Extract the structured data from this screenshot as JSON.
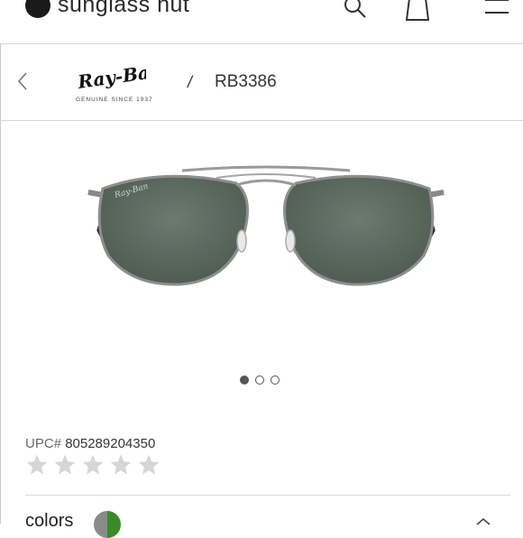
{
  "header": {
    "brand_name": "sunglass hut",
    "icons": [
      "search-icon",
      "shopping-bag-icon",
      "menu-icon"
    ]
  },
  "breadcrumb": {
    "brand_logo_text": "Ray-Ban",
    "brand_tagline": "GENUINE SINCE 1937",
    "separator": "/",
    "model": "RB3386"
  },
  "gallery": {
    "image_count": 3,
    "active_index": 0
  },
  "product": {
    "upc_label": "UPC#",
    "upc_value": "805289204350",
    "rating_stars": 5,
    "rating_filled": 0
  },
  "colors": {
    "label": "colors",
    "swatch_colors": [
      "#8a8a8a",
      "#3a8a2a"
    ]
  }
}
